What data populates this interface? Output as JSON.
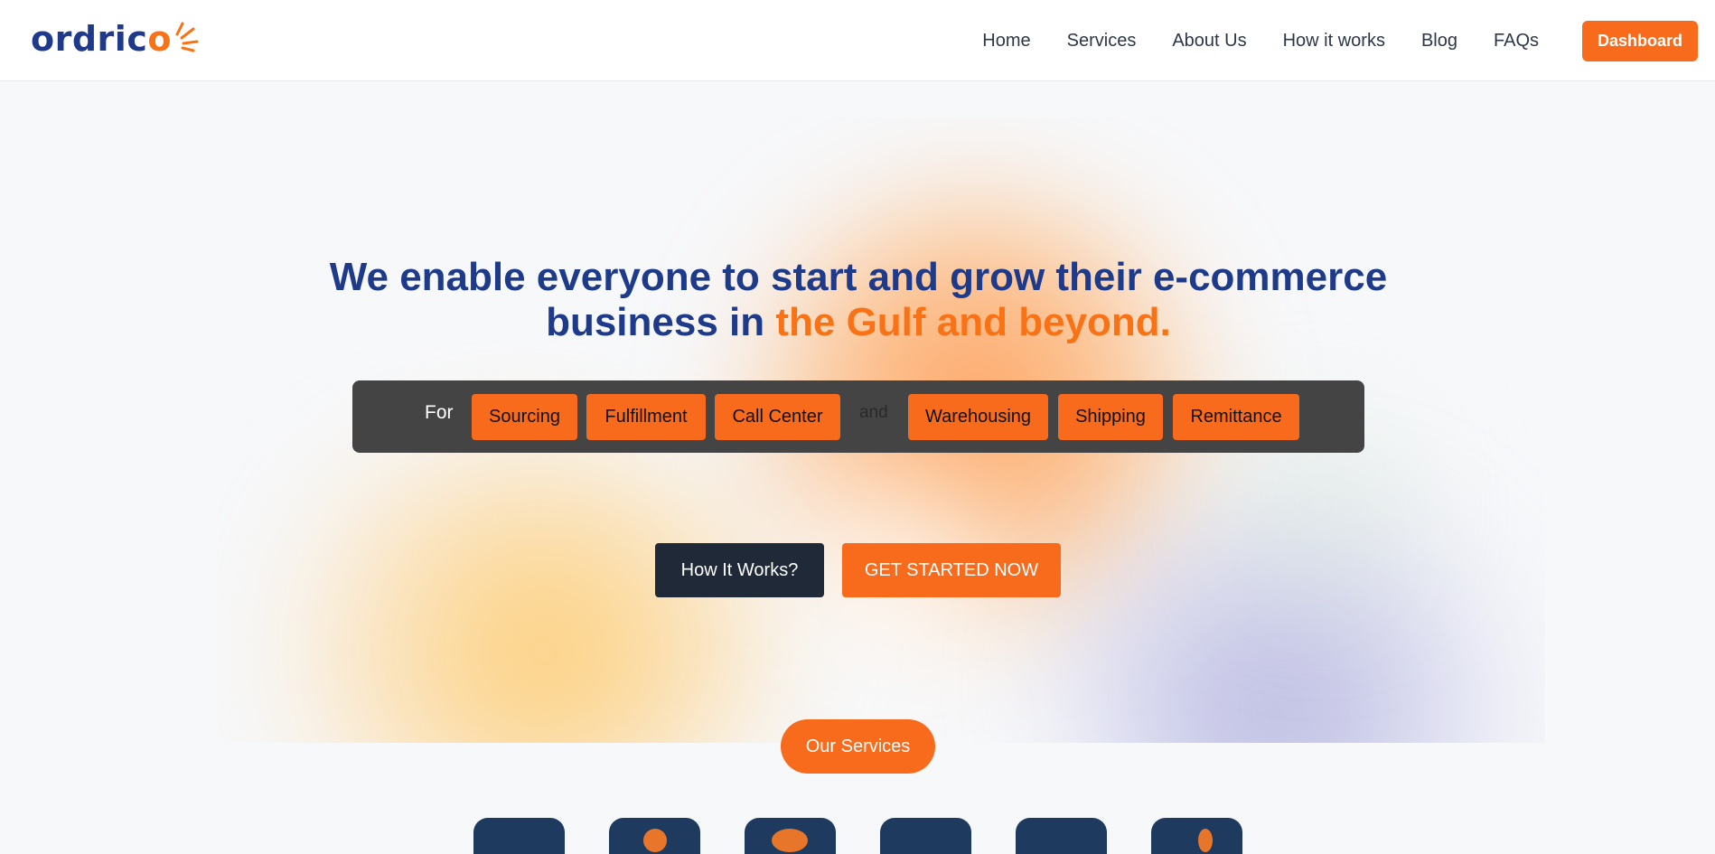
{
  "brand": {
    "logo_text_main": "ordric",
    "logo_text_o": "o",
    "accent_color": "#f86b1c",
    "primary_color": "#1e3a8a"
  },
  "nav": {
    "items": [
      {
        "label": "Home"
      },
      {
        "label": "Services"
      },
      {
        "label": "About Us"
      },
      {
        "label": "How it works"
      },
      {
        "label": "Blog"
      },
      {
        "label": "FAQs"
      }
    ],
    "dashboard_label": "Dashboard"
  },
  "hero": {
    "headline_part1": "We enable everyone to start and grow their e-commerce business in ",
    "headline_accent": "the Gulf and beyond.",
    "tag_prefix": "For",
    "tag_joiner": "and",
    "tags_left": [
      "Sourcing",
      "Fulfillment",
      "Call Center"
    ],
    "tags_right": [
      "Warehousing",
      "Shipping",
      "Remittance"
    ],
    "how_button": "How It Works?",
    "start_button": "GET STARTED NOW"
  },
  "services": {
    "pill_label": "Our Services",
    "icons": [
      "service-icon-1",
      "service-icon-2",
      "service-icon-3",
      "service-icon-4",
      "service-icon-5",
      "service-icon-6"
    ]
  }
}
